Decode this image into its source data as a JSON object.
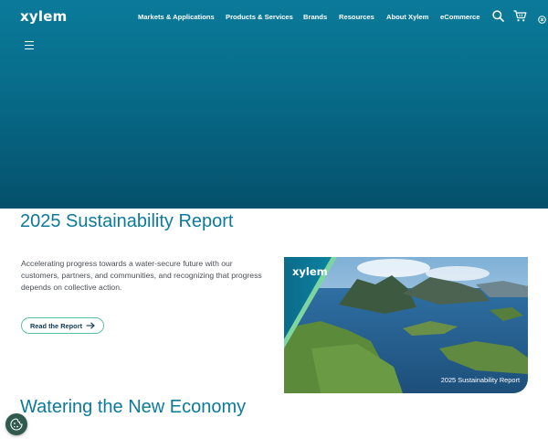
{
  "header": {
    "logo": "xylem",
    "nav": [
      {
        "label": "Markets & Applications"
      },
      {
        "label": "Products & Services"
      },
      {
        "label": "Brands"
      },
      {
        "label": "Resources"
      },
      {
        "label": "About Xylem"
      },
      {
        "label": "eCommerce"
      }
    ],
    "icons": [
      "search-icon",
      "cart-icon",
      "close-icon",
      "menu-icon"
    ]
  },
  "main": {
    "title": "2025 Sustainability Report",
    "intro": "Accelerating progress towards a water-secure future with our customers, partners, and communities, and recognizing that progress depends on collective action.",
    "cta_label": "Read the Report",
    "cover": {
      "logo": "xylem",
      "caption": "2025 Sustainability Report"
    },
    "subtitle": "Watering the New Economy"
  },
  "colors": {
    "hero_top": "#0b7a9a",
    "hero_bottom": "#05506a",
    "heading": "#0c7a9b",
    "cta_border": "#5bc0a8",
    "cookie": "#2f5a4d"
  }
}
